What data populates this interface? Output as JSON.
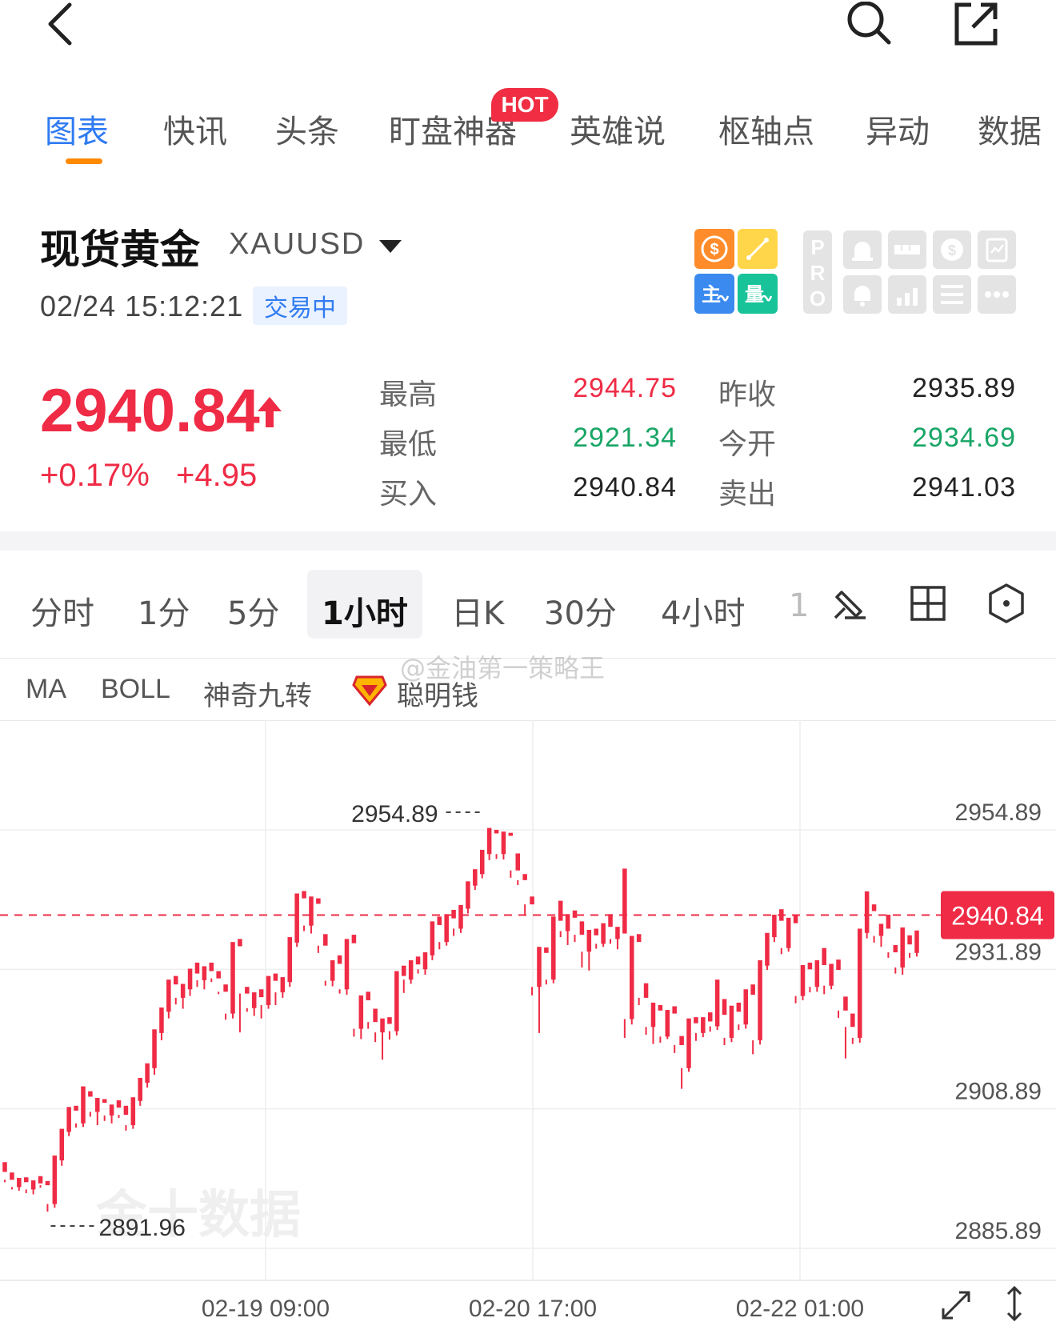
{
  "nav": {
    "tabs": [
      "图表",
      "快讯",
      "头条",
      "盯盘神器",
      "英雄说",
      "枢轴点",
      "异动",
      "数据"
    ],
    "active_tab": "图表",
    "hot_badge": "HOT"
  },
  "instrument": {
    "name": "现货黄金",
    "symbol": "XAUUSD",
    "datetime": "02/24 15:12:21",
    "status": "交易中",
    "price": "2940.84",
    "change_pct": "+0.17%",
    "change_abs": "+4.95",
    "quote": {
      "high_label": "最高",
      "high": "2944.75",
      "low_label": "最低",
      "low": "2921.34",
      "bid_label": "买入",
      "bid": "2940.84",
      "prev_close_label": "昨收",
      "prev_close": "2935.89",
      "open_label": "今开",
      "open": "2934.69",
      "ask_label": "卖出",
      "ask": "2941.03"
    }
  },
  "tools": {
    "colored": [
      "dollar-icon",
      "line-tool-icon",
      "trend-icon",
      "quant-icon"
    ],
    "pro_letters": "PRO",
    "grey": [
      "alarm-icon",
      "ruler-icon",
      "coin-icon",
      "clipboard-icon",
      "bell-icon",
      "bar-chart-icon",
      "list-icon",
      "more-icon"
    ]
  },
  "periods": {
    "items": [
      "分时",
      "1分",
      "5分",
      "1小时",
      "日K",
      "30分",
      "4小时",
      "1"
    ],
    "active": "1小时"
  },
  "indicators": {
    "items": [
      "MA",
      "BOLL",
      "神奇九转",
      "聪明钱"
    ],
    "watermark": "@金油第一策略王"
  },
  "chart_data": {
    "type": "candlestick",
    "y_ticks": [
      "2954.89",
      "2931.89",
      "2908.89",
      "2885.89"
    ],
    "ylim": [
      2885.89,
      2954.89
    ],
    "x_ticks": [
      "02-19 09:00",
      "02-20 17:00",
      "02-22 01:00"
    ],
    "current_price_label": "2940.84",
    "current_price": 2940.84,
    "max_label": "2954.89",
    "max_value": 2954.89,
    "min_label": "2891.96",
    "min_value": 2891.96,
    "logo_text": "金十数据",
    "colors": {
      "up": "#ef2b45",
      "down": "#18a566",
      "grid": "#eeeeee",
      "price_line": "#ef2b45"
    },
    "candles": [
      [
        2898.5,
        2900.1,
        2896.8,
        2897.2
      ],
      [
        2897.2,
        2898.4,
        2895.6,
        2896.0
      ],
      [
        2896.0,
        2897.5,
        2895.4,
        2896.8
      ],
      [
        2896.8,
        2897.6,
        2895.0,
        2895.6
      ],
      [
        2895.6,
        2897.1,
        2894.8,
        2896.6
      ],
      [
        2896.6,
        2897.8,
        2895.9,
        2896.3
      ],
      [
        2896.3,
        2897.0,
        2891.96,
        2893.2
      ],
      [
        2893.2,
        2901.2,
        2892.6,
        2900.4
      ],
      [
        2900.4,
        2905.6,
        2899.5,
        2905.1
      ],
      [
        2905.1,
        2909.2,
        2904.4,
        2908.6
      ],
      [
        2908.6,
        2909.4,
        2905.8,
        2906.5
      ],
      [
        2906.5,
        2912.6,
        2905.9,
        2910.9
      ],
      [
        2910.9,
        2911.8,
        2907.6,
        2908.4
      ],
      [
        2908.4,
        2910.7,
        2906.2,
        2909.9
      ],
      [
        2909.9,
        2910.5,
        2906.9,
        2907.8
      ],
      [
        2907.8,
        2909.6,
        2906.5,
        2909.1
      ],
      [
        2909.1,
        2910.3,
        2907.4,
        2907.9
      ],
      [
        2907.9,
        2909.4,
        2905.3,
        2906.2
      ],
      [
        2906.2,
        2910.8,
        2905.6,
        2910.2
      ],
      [
        2910.2,
        2914.0,
        2909.4,
        2913.2
      ],
      [
        2913.2,
        2916.4,
        2912.4,
        2915.6
      ],
      [
        2915.6,
        2922.0,
        2914.5,
        2921.4
      ],
      [
        2921.4,
        2925.6,
        2920.2,
        2924.9
      ],
      [
        2924.9,
        2930.2,
        2923.8,
        2929.4
      ],
      [
        2929.4,
        2930.8,
        2926.1,
        2927.2
      ],
      [
        2927.2,
        2929.5,
        2925.4,
        2928.6
      ],
      [
        2928.6,
        2932.0,
        2927.5,
        2931.2
      ],
      [
        2931.2,
        2933.0,
        2929.0,
        2930.1
      ],
      [
        2930.1,
        2932.4,
        2928.6,
        2931.6
      ],
      [
        2931.6,
        2933.0,
        2929.8,
        2930.4
      ],
      [
        2930.4,
        2931.6,
        2927.8,
        2928.2
      ],
      [
        2928.2,
        2929.4,
        2923.6,
        2924.6
      ],
      [
        2924.6,
        2936.4,
        2923.8,
        2935.7
      ],
      [
        2935.7,
        2936.9,
        2921.5,
        2927.9
      ],
      [
        2927.9,
        2929.0,
        2924.9,
        2925.5
      ],
      [
        2925.5,
        2928.1,
        2924.2,
        2927.3
      ],
      [
        2927.3,
        2928.6,
        2923.8,
        2926.0
      ],
      [
        2926.0,
        2930.8,
        2925.4,
        2930.0
      ],
      [
        2930.0,
        2931.2,
        2926.0,
        2928.1
      ],
      [
        2928.1,
        2930.6,
        2927.2,
        2929.8
      ],
      [
        2929.8,
        2937.2,
        2929.0,
        2936.3
      ],
      [
        2936.3,
        2944.4,
        2935.6,
        2943.6
      ],
      [
        2943.6,
        2944.8,
        2938.2,
        2939.1
      ],
      [
        2939.1,
        2943.9,
        2937.8,
        2942.7
      ],
      [
        2942.7,
        2943.6,
        2934.6,
        2935.8
      ],
      [
        2935.8,
        2937.7,
        2929.2,
        2930.0
      ],
      [
        2930.0,
        2933.4,
        2929.1,
        2932.8
      ],
      [
        2932.8,
        2934.2,
        2927.9,
        2928.6
      ],
      [
        2928.6,
        2936.9,
        2927.7,
        2936.2
      ],
      [
        2936.2,
        2937.6,
        2920.8,
        2922.1
      ],
      [
        2922.1,
        2927.6,
        2920.4,
        2926.8
      ],
      [
        2926.8,
        2928.2,
        2922.1,
        2923.2
      ],
      [
        2923.2,
        2925.4,
        2919.9,
        2921.5
      ],
      [
        2921.5,
        2923.8,
        2917.0,
        2922.9
      ],
      [
        2922.9,
        2924.0,
        2920.3,
        2921.7
      ],
      [
        2921.7,
        2931.6,
        2921.0,
        2930.8
      ],
      [
        2930.8,
        2932.5,
        2928.0,
        2930.2
      ],
      [
        2930.2,
        2933.4,
        2929.5,
        2932.7
      ],
      [
        2932.7,
        2934.0,
        2931.2,
        2931.9
      ],
      [
        2931.9,
        2934.7,
        2931.0,
        2934.2
      ],
      [
        2934.2,
        2939.8,
        2933.4,
        2939.2
      ],
      [
        2939.2,
        2940.6,
        2935.2,
        2936.4
      ],
      [
        2936.4,
        2941.0,
        2935.8,
        2940.3
      ],
      [
        2940.3,
        2941.7,
        2937.4,
        2938.6
      ],
      [
        2938.6,
        2942.5,
        2937.9,
        2941.9
      ],
      [
        2941.9,
        2946.4,
        2941.1,
        2945.7
      ],
      [
        2945.7,
        2948.4,
        2945.0,
        2947.6
      ],
      [
        2947.6,
        2951.6,
        2946.9,
        2950.9
      ],
      [
        2950.9,
        2955.2,
        2949.9,
        2954.3
      ],
      [
        2954.3,
        2954.89,
        2950.1,
        2950.9
      ],
      [
        2950.9,
        2954.6,
        2950.0,
        2953.9
      ],
      [
        2953.9,
        2954.4,
        2947.0,
        2948.2
      ],
      [
        2948.2,
        2951.0,
        2945.8,
        2946.6
      ],
      [
        2946.6,
        2947.6,
        2940.8,
        2942.6
      ],
      [
        2942.6,
        2943.9,
        2927.6,
        2929.0
      ],
      [
        2929.0,
        2935.6,
        2921.4,
        2934.6
      ],
      [
        2934.6,
        2935.5,
        2929.4,
        2930.2
      ],
      [
        2930.2,
        2940.6,
        2929.6,
        2939.9
      ],
      [
        2939.9,
        2943.2,
        2937.2,
        2938.2
      ],
      [
        2938.2,
        2941.0,
        2935.9,
        2940.4
      ],
      [
        2940.4,
        2941.6,
        2936.4,
        2937.6
      ],
      [
        2937.6,
        2939.8,
        2932.2,
        2934.8
      ],
      [
        2934.8,
        2938.4,
        2931.7,
        2937.5
      ],
      [
        2937.5,
        2938.6,
        2935.3,
        2936.1
      ],
      [
        2936.1,
        2939.5,
        2935.6,
        2938.9
      ],
      [
        2938.9,
        2941.0,
        2936.1,
        2936.9
      ],
      [
        2936.9,
        2938.9,
        2935.2,
        2937.8
      ],
      [
        2937.8,
        2948.5,
        2920.6,
        2923.7
      ],
      [
        2923.7,
        2937.4,
        2922.8,
        2936.4
      ],
      [
        2936.4,
        2937.7,
        2926.0,
        2927.2
      ],
      [
        2927.2,
        2929.6,
        2921.1,
        2922.4
      ],
      [
        2922.4,
        2926.4,
        2919.6,
        2925.1
      ],
      [
        2925.1,
        2926.0,
        2919.8,
        2920.8
      ],
      [
        2920.8,
        2925.2,
        2920.4,
        2924.6
      ],
      [
        2924.6,
        2925.8,
        2918.1,
        2919.4
      ],
      [
        2919.4,
        2920.9,
        2912.2,
        2915.6
      ],
      [
        2915.6,
        2923.8,
        2915.0,
        2923.0
      ],
      [
        2923.0,
        2924.0,
        2920.1,
        2921.4
      ],
      [
        2921.4,
        2924.0,
        2920.7,
        2923.3
      ],
      [
        2923.3,
        2924.8,
        2921.6,
        2922.5
      ],
      [
        2922.5,
        2930.2,
        2921.9,
        2924.4
      ],
      [
        2924.4,
        2927.0,
        2919.4,
        2920.6
      ],
      [
        2920.6,
        2925.9,
        2919.9,
        2924.9
      ],
      [
        2924.9,
        2926.4,
        2921.9,
        2922.8
      ],
      [
        2922.8,
        2928.6,
        2922.1,
        2927.7
      ],
      [
        2927.7,
        2929.4,
        2917.9,
        2920.2
      ],
      [
        2920.2,
        2933.4,
        2919.5,
        2932.5
      ],
      [
        2932.5,
        2937.9,
        2931.8,
        2937.2
      ],
      [
        2937.2,
        2940.9,
        2936.4,
        2939.9
      ],
      [
        2939.9,
        2941.8,
        2934.4,
        2935.4
      ],
      [
        2935.4,
        2940.4,
        2934.8,
        2939.5
      ],
      [
        2939.5,
        2940.8,
        2926.3,
        2927.5
      ],
      [
        2927.5,
        2932.6,
        2926.8,
        2931.9
      ],
      [
        2931.9,
        2933.0,
        2928.1,
        2929.0
      ],
      [
        2929.0,
        2933.4,
        2928.2,
        2932.6
      ],
      [
        2932.6,
        2935.4,
        2927.8,
        2929.2
      ],
      [
        2929.2,
        2932.8,
        2928.6,
        2931.8
      ],
      [
        2931.8,
        2933.5,
        2923.9,
        2925.1
      ],
      [
        2925.1,
        2927.4,
        2917.2,
        2922.4
      ],
      [
        2922.4,
        2924.6,
        2919.6,
        2920.6
      ],
      [
        2920.6,
        2938.6,
        2919.8,
        2937.9
      ],
      [
        2937.9,
        2944.75,
        2937.0,
        2941.5
      ],
      [
        2941.5,
        2942.6,
        2936.3,
        2937.4
      ],
      [
        2937.4,
        2939.4,
        2935.6,
        2938.6
      ],
      [
        2938.6,
        2940.9,
        2933.8,
        2934.7
      ],
      [
        2934.7,
        2935.9,
        2931.2,
        2932.2
      ],
      [
        2932.2,
        2938.8,
        2931.0,
        2936.0
      ],
      [
        2936.0,
        2937.5,
        2933.8,
        2934.6
      ],
      [
        2934.6,
        2938.3,
        2934.0,
        2937.4
      ]
    ]
  }
}
